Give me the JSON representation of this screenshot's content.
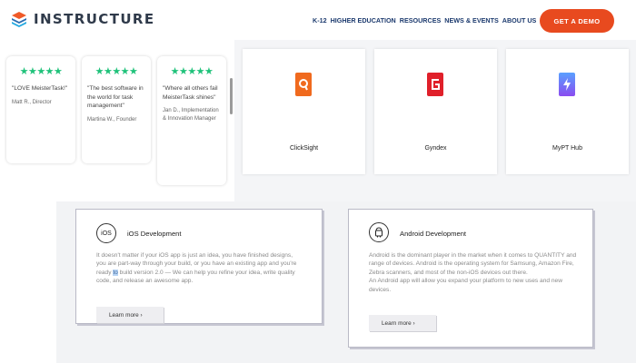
{
  "header": {
    "logo_text": "INSTRUCTURE",
    "nav": [
      "K-12",
      "HIGHER EDUCATION",
      "RESOURCES",
      "NEWS & EVENTS",
      "ABOUT US"
    ],
    "cta_label": "GET A DEMO"
  },
  "reviews": [
    {
      "stars": "★★★★★",
      "quote": "\"LOVE MeisterTask!\"",
      "author": "Matt R., Director"
    },
    {
      "stars": "★★★★★",
      "quote": "\"The best software in the world for task management\"",
      "author": "Martina W., Founder"
    },
    {
      "stars": "★★★★★",
      "quote": "\"Where all others fail MeisterTask shines\"",
      "author": "Jan D., Implementation & Innovation Manager"
    }
  ],
  "integrations": [
    {
      "name": "ClickSight",
      "icon": "clicksight-logo-icon",
      "color": "#f06a1e"
    },
    {
      "name": "Gyndex",
      "icon": "gyndex-logo-icon",
      "color": "#e0202a"
    },
    {
      "name": "MyPT Hub",
      "icon": "myp-thub-logo-icon",
      "color": "#6a5cf0"
    }
  ],
  "services": {
    "ios": {
      "icon_label": "iOS",
      "title": "iOS Development",
      "desc_before": "It doesn't matter if your iOS app is just an idea, you have finished designs, you are part-way through your build, or you have an existing app and you're ready ",
      "desc_highlight": "to",
      "desc_after": " build version 2.0 — We can help you refine your idea, write quality code, and release an awesome app.",
      "button": "Learn more ›"
    },
    "android": {
      "title": "Android Development",
      "desc": "Android is the dominant player in the market when it comes to QUANTITY and range of devices. Android is the operating system for Samsung, Amazon Fire, Zebra scanners, and most of the non-iOS devices out there.\nAn Android app will allow you expand your platform to new uses and new devices.",
      "button": "Learn more ›"
    }
  },
  "colors": {
    "accent": "#e84a1f",
    "stars": "#1fc27a",
    "nav": "#1c3a6e"
  }
}
